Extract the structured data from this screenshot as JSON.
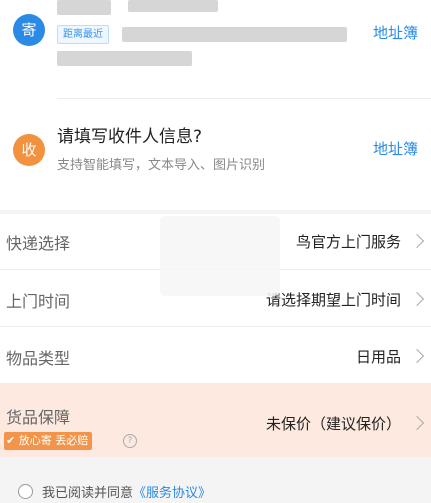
{
  "sender": {
    "icon_label": "寄",
    "icon_color": "#2a8ae6",
    "nearest_tag": "距离最近",
    "address_book": "地址簿"
  },
  "receiver": {
    "icon_label": "收",
    "icon_color": "#f2913e",
    "prompt": "请填写收件人信息?",
    "hint": "支持智能填写，文本导入、图片识别",
    "address_book": "地址簿"
  },
  "options": [
    {
      "label": "快递选择",
      "value": "鸟官方上门服务"
    },
    {
      "label": "上门时间",
      "value": "请选择期望上门时间"
    },
    {
      "label": "物品类型",
      "value": "日用品"
    }
  ],
  "guarantee": {
    "label": "货品保障",
    "tag": "放心寄 丢必赔",
    "value": "未保价（建议保价）",
    "bg_color": "#fde9df"
  },
  "agreement": {
    "text": "我已阅读并同意",
    "link": "《服务协议》"
  }
}
